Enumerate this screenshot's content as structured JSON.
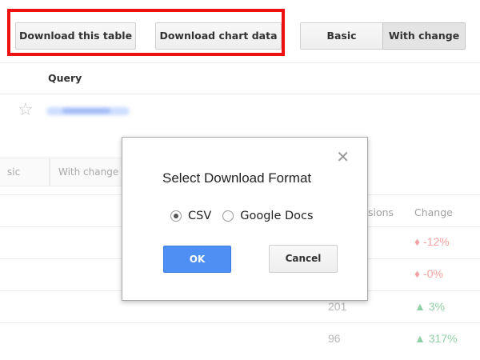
{
  "toolbar": {
    "download_table_label": "Download this table",
    "download_chart_label": "Download chart data",
    "view_basic_label": "Basic",
    "view_with_change_label": "With change"
  },
  "table_top": {
    "query_header": "Query",
    "star_icon": "star-icon"
  },
  "background_table": {
    "tab_basic_partial": "sic",
    "tab_with_change": "With change",
    "col_impressions_partial": "sions",
    "col_change": "Change",
    "rows": [
      {
        "value": "",
        "change": "-12%",
        "direction": "down"
      },
      {
        "value": "",
        "change": "-0%",
        "direction": "down"
      },
      {
        "value": "201",
        "change": "3%",
        "direction": "up"
      },
      {
        "value": "96",
        "change": "317%",
        "direction": "up"
      }
    ]
  },
  "dialog": {
    "title": "Select Download Format",
    "close_icon": "close-icon",
    "option_csv": "CSV",
    "option_google_docs": "Google Docs",
    "selected_option": "CSV",
    "ok_label": "OK",
    "cancel_label": "Cancel"
  },
  "colors": {
    "highlight_border": "#ee1111",
    "ok_button": "#4d8ff2",
    "negative_change": "#f3a2a2",
    "positive_change": "#8fd0a6"
  }
}
